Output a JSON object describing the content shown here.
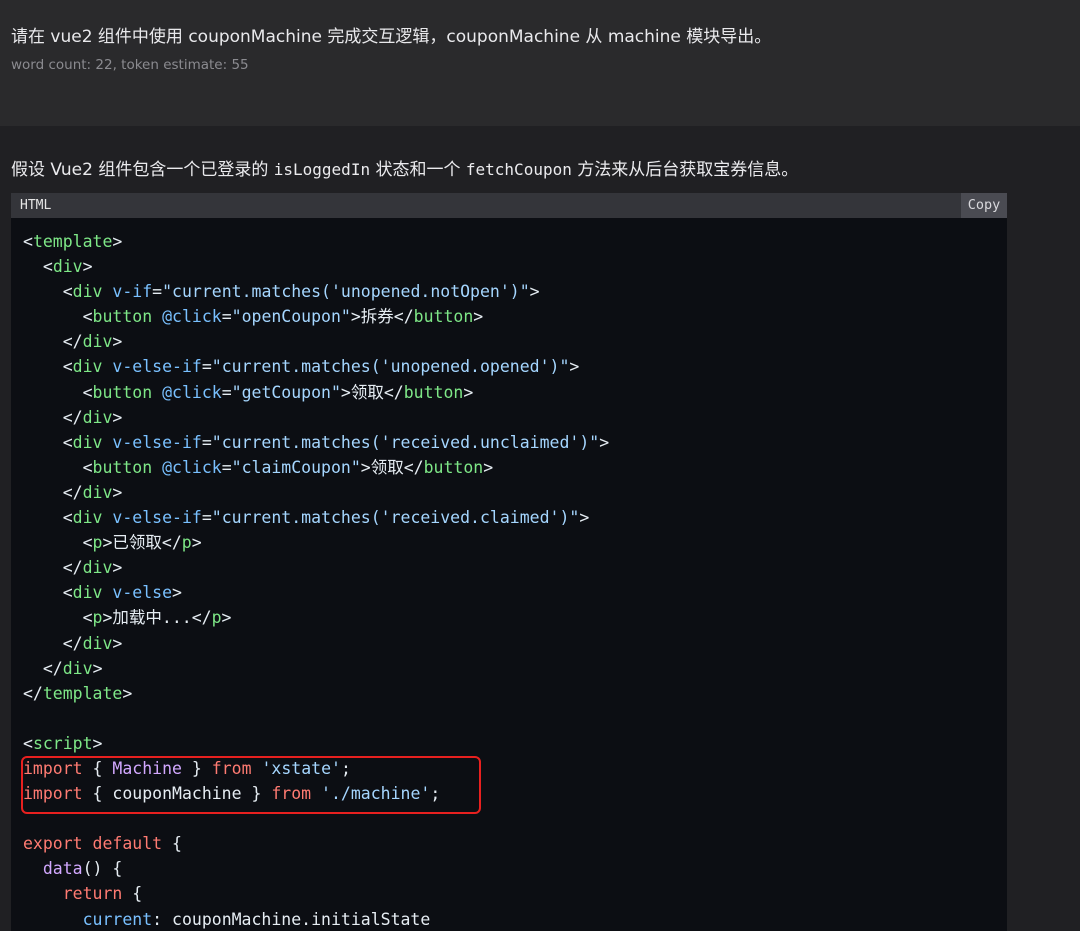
{
  "user_message": {
    "text": "请在 vue2 组件中使用 couponMachine 完成交互逻辑，couponMachine 从 machine 模块导出。",
    "word_count": "word count: 22, token estimate: 55"
  },
  "assistant_message": {
    "intro_before_1": "假设 Vue2 组件包含一个已登录的 ",
    "intro_code_1": "isLoggedIn",
    "intro_between": " 状态和一个 ",
    "intro_code_2": "fetchCoupon",
    "intro_after": " 方法来从后台获取宝券信息。"
  },
  "code_block": {
    "language": "HTML",
    "copy_label": "Copy",
    "lines": [
      [
        [
          "t-punc",
          "<"
        ],
        [
          "t-tag",
          "template"
        ],
        [
          "t-punc",
          ">"
        ]
      ],
      [
        [
          "t-punc",
          "  <"
        ],
        [
          "t-tag",
          "div"
        ],
        [
          "t-punc",
          ">"
        ]
      ],
      [
        [
          "t-punc",
          "    <"
        ],
        [
          "t-tag",
          "div"
        ],
        [
          "t-punc",
          " "
        ],
        [
          "t-attr",
          "v-if"
        ],
        [
          "t-punc",
          "="
        ],
        [
          "t-str",
          "\"current.matches('unopened.notOpen')\""
        ],
        [
          "t-punc",
          ">"
        ]
      ],
      [
        [
          "t-punc",
          "      <"
        ],
        [
          "t-tag",
          "button"
        ],
        [
          "t-punc",
          " "
        ],
        [
          "t-attr",
          "@click"
        ],
        [
          "t-punc",
          "="
        ],
        [
          "t-str",
          "\"openCoupon\""
        ],
        [
          "t-punc",
          ">"
        ],
        [
          "t-text",
          "拆券"
        ],
        [
          "t-punc",
          "</"
        ],
        [
          "t-tag",
          "button"
        ],
        [
          "t-punc",
          ">"
        ]
      ],
      [
        [
          "t-punc",
          "    </"
        ],
        [
          "t-tag",
          "div"
        ],
        [
          "t-punc",
          ">"
        ]
      ],
      [
        [
          "t-punc",
          "    <"
        ],
        [
          "t-tag",
          "div"
        ],
        [
          "t-punc",
          " "
        ],
        [
          "t-attr",
          "v-else-if"
        ],
        [
          "t-punc",
          "="
        ],
        [
          "t-str",
          "\"current.matches('unopened.opened')\""
        ],
        [
          "t-punc",
          ">"
        ]
      ],
      [
        [
          "t-punc",
          "      <"
        ],
        [
          "t-tag",
          "button"
        ],
        [
          "t-punc",
          " "
        ],
        [
          "t-attr",
          "@click"
        ],
        [
          "t-punc",
          "="
        ],
        [
          "t-str",
          "\"getCoupon\""
        ],
        [
          "t-punc",
          ">"
        ],
        [
          "t-text",
          "领取"
        ],
        [
          "t-punc",
          "</"
        ],
        [
          "t-tag",
          "button"
        ],
        [
          "t-punc",
          ">"
        ]
      ],
      [
        [
          "t-punc",
          "    </"
        ],
        [
          "t-tag",
          "div"
        ],
        [
          "t-punc",
          ">"
        ]
      ],
      [
        [
          "t-punc",
          "    <"
        ],
        [
          "t-tag",
          "div"
        ],
        [
          "t-punc",
          " "
        ],
        [
          "t-attr",
          "v-else-if"
        ],
        [
          "t-punc",
          "="
        ],
        [
          "t-str",
          "\"current.matches('received.unclaimed')\""
        ],
        [
          "t-punc",
          ">"
        ]
      ],
      [
        [
          "t-punc",
          "      <"
        ],
        [
          "t-tag",
          "button"
        ],
        [
          "t-punc",
          " "
        ],
        [
          "t-attr",
          "@click"
        ],
        [
          "t-punc",
          "="
        ],
        [
          "t-str",
          "\"claimCoupon\""
        ],
        [
          "t-punc",
          ">"
        ],
        [
          "t-text",
          "领取"
        ],
        [
          "t-punc",
          "</"
        ],
        [
          "t-tag",
          "button"
        ],
        [
          "t-punc",
          ">"
        ]
      ],
      [
        [
          "t-punc",
          "    </"
        ],
        [
          "t-tag",
          "div"
        ],
        [
          "t-punc",
          ">"
        ]
      ],
      [
        [
          "t-punc",
          "    <"
        ],
        [
          "t-tag",
          "div"
        ],
        [
          "t-punc",
          " "
        ],
        [
          "t-attr",
          "v-else-if"
        ],
        [
          "t-punc",
          "="
        ],
        [
          "t-str",
          "\"current.matches('received.claimed')\""
        ],
        [
          "t-punc",
          ">"
        ]
      ],
      [
        [
          "t-punc",
          "      <"
        ],
        [
          "t-tag",
          "p"
        ],
        [
          "t-punc",
          ">"
        ],
        [
          "t-text",
          "已领取"
        ],
        [
          "t-punc",
          "</"
        ],
        [
          "t-tag",
          "p"
        ],
        [
          "t-punc",
          ">"
        ]
      ],
      [
        [
          "t-punc",
          "    </"
        ],
        [
          "t-tag",
          "div"
        ],
        [
          "t-punc",
          ">"
        ]
      ],
      [
        [
          "t-punc",
          "    <"
        ],
        [
          "t-tag",
          "div"
        ],
        [
          "t-punc",
          " "
        ],
        [
          "t-attr",
          "v-else"
        ],
        [
          "t-punc",
          ">"
        ]
      ],
      [
        [
          "t-punc",
          "      <"
        ],
        [
          "t-tag",
          "p"
        ],
        [
          "t-punc",
          ">"
        ],
        [
          "t-text",
          "加载中..."
        ],
        [
          "t-punc",
          "</"
        ],
        [
          "t-tag",
          "p"
        ],
        [
          "t-punc",
          ">"
        ]
      ],
      [
        [
          "t-punc",
          "    </"
        ],
        [
          "t-tag",
          "div"
        ],
        [
          "t-punc",
          ">"
        ]
      ],
      [
        [
          "t-punc",
          "  </"
        ],
        [
          "t-tag",
          "div"
        ],
        [
          "t-punc",
          ">"
        ]
      ],
      [
        [
          "t-punc",
          "</"
        ],
        [
          "t-tag",
          "template"
        ],
        [
          "t-punc",
          ">"
        ]
      ],
      [
        [
          "t-punc",
          ""
        ]
      ],
      [
        [
          "t-punc",
          "<"
        ],
        [
          "t-tag",
          "script"
        ],
        [
          "t-punc",
          ">"
        ]
      ],
      [
        [
          "t-kw",
          "import"
        ],
        [
          "t-punc",
          " { "
        ],
        [
          "t-cls",
          "Machine"
        ],
        [
          "t-punc",
          " } "
        ],
        [
          "t-kw",
          "from"
        ],
        [
          "t-punc",
          " "
        ],
        [
          "t-str",
          "'xstate'"
        ],
        [
          "t-punc",
          ";"
        ]
      ],
      [
        [
          "t-kw",
          "import"
        ],
        [
          "t-punc",
          " { couponMachine } "
        ],
        [
          "t-kw",
          "from"
        ],
        [
          "t-punc",
          " "
        ],
        [
          "t-str",
          "'./machine'"
        ],
        [
          "t-punc",
          ";"
        ]
      ],
      [
        [
          "t-punc",
          ""
        ]
      ],
      [
        [
          "t-kw",
          "export"
        ],
        [
          "t-punc",
          " "
        ],
        [
          "t-kw",
          "default"
        ],
        [
          "t-punc",
          " {"
        ]
      ],
      [
        [
          "t-punc",
          "  "
        ],
        [
          "t-fn",
          "data"
        ],
        [
          "t-punc",
          "() {"
        ]
      ],
      [
        [
          "t-punc",
          "    "
        ],
        [
          "t-kw",
          "return"
        ],
        [
          "t-punc",
          " {"
        ]
      ],
      [
        [
          "t-punc",
          "      "
        ],
        [
          "t-var",
          "current"
        ],
        [
          "t-punc",
          ": couponMachine.initialState"
        ]
      ]
    ]
  },
  "colors": {
    "highlight_border": "#e8201f",
    "code_background": "#0c0e13"
  }
}
